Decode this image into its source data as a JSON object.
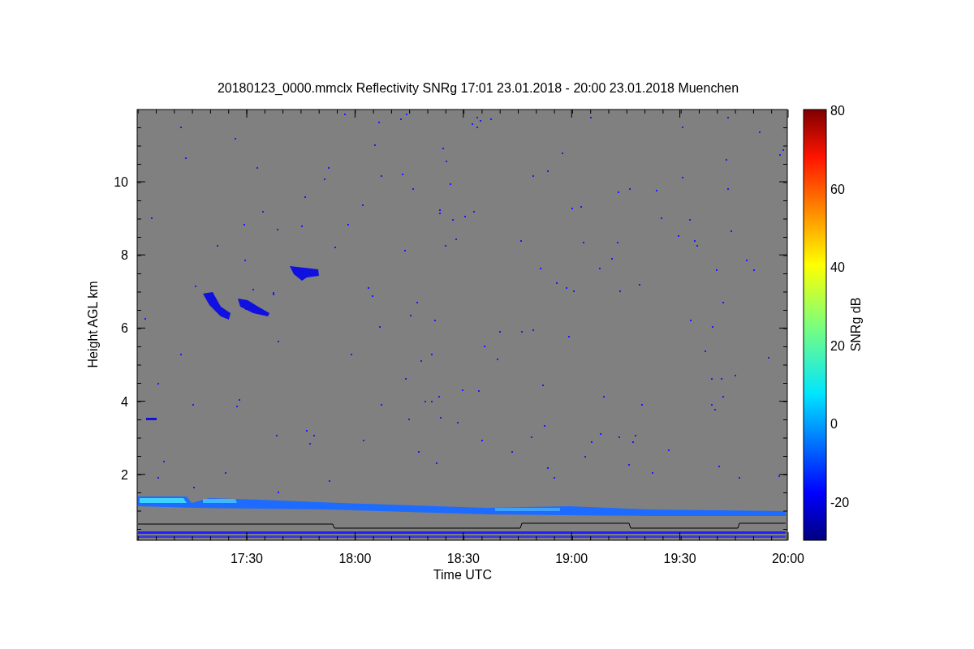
{
  "chart": {
    "title": "20180123_0000.mmclx Reflectivity SNRg   17:01 23.01.2018 - 20:00 23.01.2018 Muenchen",
    "xlabel": "Time UTC",
    "ylabel": "Height AGL km",
    "xticks": [
      "17:30",
      "18:00",
      "18:30",
      "19:00",
      "19:30",
      "20:00"
    ],
    "yticks": [
      "10",
      "8",
      "6",
      "4",
      "2"
    ],
    "colorbar": {
      "label": "SNRg dB",
      "ticks": [
        "80",
        "60",
        "40",
        "20",
        "0",
        "-20"
      ]
    }
  }
}
